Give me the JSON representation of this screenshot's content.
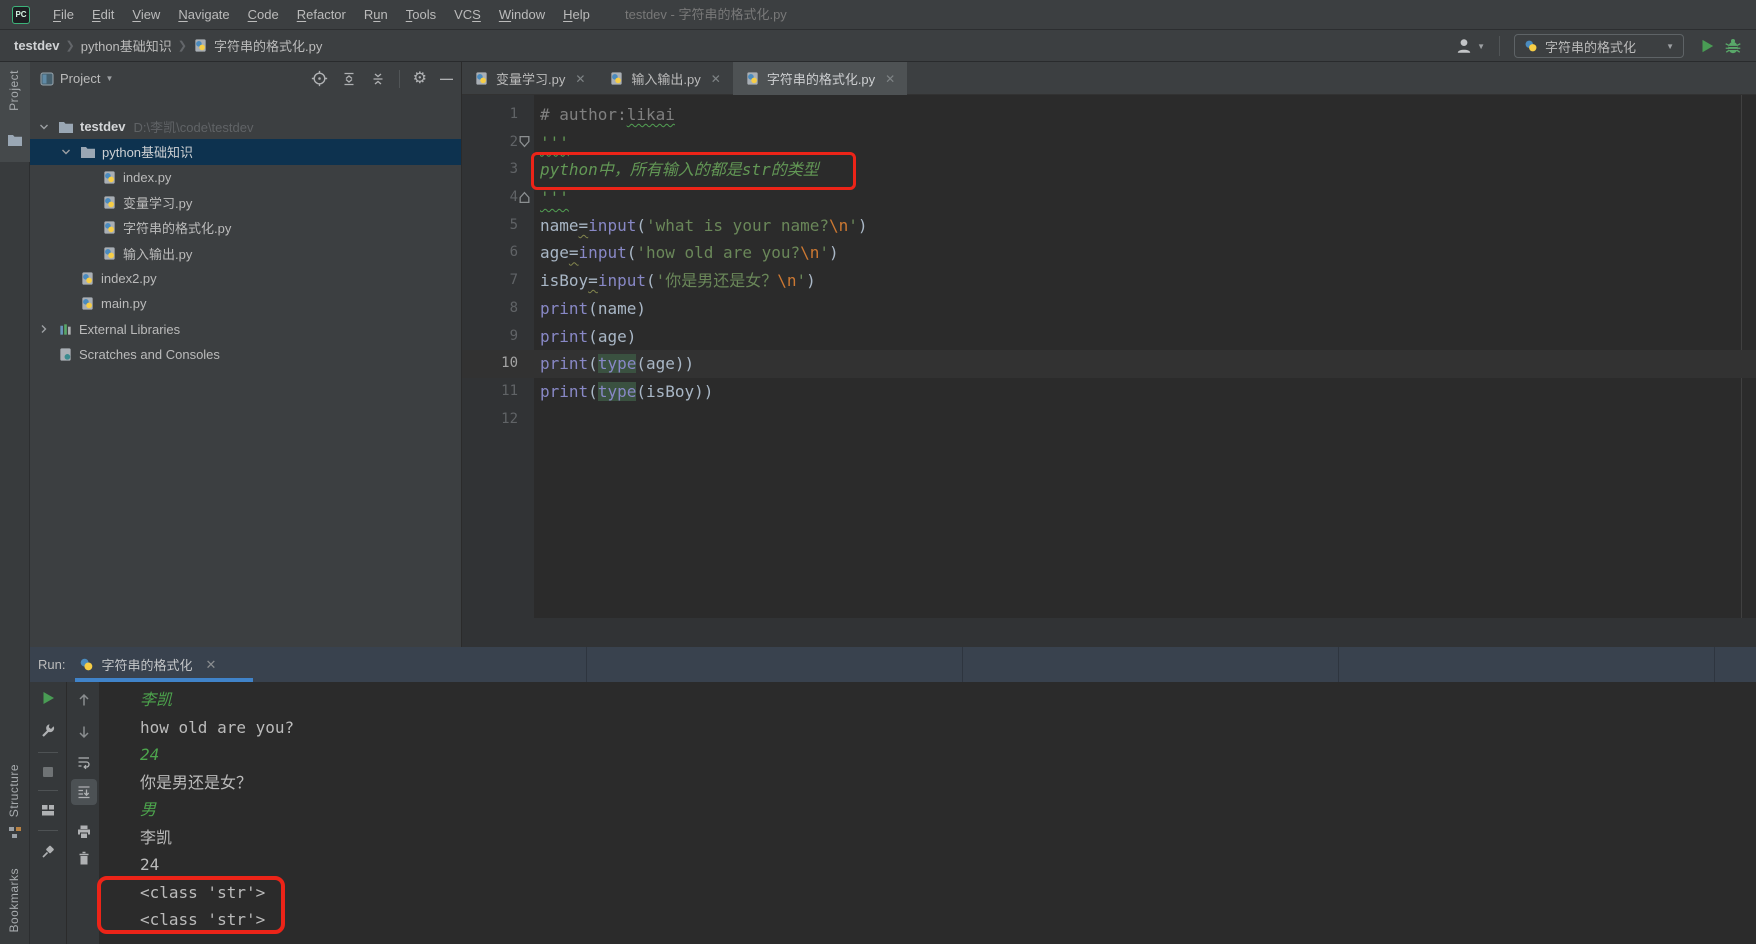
{
  "window": {
    "title": "testdev - 字符串的格式化.py",
    "logo": "PC"
  },
  "menu": {
    "items": [
      {
        "pre": "",
        "key": "F",
        "post": "ile"
      },
      {
        "pre": "",
        "key": "E",
        "post": "dit"
      },
      {
        "pre": "",
        "key": "V",
        "post": "iew"
      },
      {
        "pre": "",
        "key": "N",
        "post": "avigate"
      },
      {
        "pre": "",
        "key": "C",
        "post": "ode"
      },
      {
        "pre": "",
        "key": "R",
        "post": "efactor"
      },
      {
        "pre": "R",
        "key": "u",
        "post": "n"
      },
      {
        "pre": "",
        "key": "T",
        "post": "ools"
      },
      {
        "pre": "VC",
        "key": "S",
        "post": ""
      },
      {
        "pre": "",
        "key": "W",
        "post": "indow"
      },
      {
        "pre": "",
        "key": "H",
        "post": "elp"
      }
    ]
  },
  "breadcrumbs": {
    "items": [
      "testdev",
      "python基础知识",
      "字符串的格式化.py"
    ]
  },
  "toolbar": {
    "run_config": "字符串的格式化"
  },
  "stripes": {
    "project": "Project",
    "structure": "Structure",
    "bookmarks": "Bookmarks"
  },
  "project_panel": {
    "title": "Project",
    "tree": [
      {
        "label": "testdev",
        "path": "D:\\李凯\\code\\testdev",
        "indent": 0,
        "icon": "folder",
        "chevron": "down",
        "bold": true
      },
      {
        "label": "python基础知识",
        "indent": 1,
        "icon": "folder",
        "chevron": "down",
        "selected": true
      },
      {
        "label": "index.py",
        "indent": 2,
        "icon": "py"
      },
      {
        "label": "变量学习.py",
        "indent": 2,
        "icon": "py"
      },
      {
        "label": "字符串的格式化.py",
        "indent": 2,
        "icon": "py"
      },
      {
        "label": "输入输出.py",
        "indent": 2,
        "icon": "py"
      },
      {
        "label": "index2.py",
        "indent": 1,
        "icon": "py"
      },
      {
        "label": "main.py",
        "indent": 1,
        "icon": "py"
      },
      {
        "label": "External Libraries",
        "indent": 0,
        "icon": "lib",
        "chevron": "right"
      },
      {
        "label": "Scratches and Consoles",
        "indent": 0,
        "icon": "scratch"
      }
    ]
  },
  "editor": {
    "tabs": [
      {
        "label": "变量学习.py",
        "active": false
      },
      {
        "label": "输入输出.py",
        "active": false
      },
      {
        "label": "字符串的格式化.py",
        "active": true
      }
    ],
    "current_line": 10,
    "lines": [
      {
        "n": 1,
        "tokens": [
          [
            "# author:",
            "cm"
          ],
          [
            "likai",
            "cm wg"
          ]
        ]
      },
      {
        "n": 2,
        "tokens": [
          [
            "'''",
            "doc wd"
          ]
        ]
      },
      {
        "n": 3,
        "tokens": [
          [
            "python中，所有输入的都是str的类型",
            "doc"
          ]
        ]
      },
      {
        "n": 4,
        "tokens": [
          [
            "'''",
            "doc wd"
          ]
        ]
      },
      {
        "n": 5,
        "tokens": [
          [
            "name",
            "pl"
          ],
          [
            "=",
            "pl ww"
          ],
          [
            "input",
            "fn"
          ],
          [
            "(",
            "pl"
          ],
          [
            "'what is your name?",
            "st"
          ],
          [
            "\\n",
            "es"
          ],
          [
            "'",
            "st"
          ],
          [
            ")",
            "pl"
          ]
        ]
      },
      {
        "n": 6,
        "tokens": [
          [
            "age",
            "pl"
          ],
          [
            "=",
            "pl ww"
          ],
          [
            "input",
            "fn"
          ],
          [
            "(",
            "pl"
          ],
          [
            "'how old are you?",
            "st"
          ],
          [
            "\\n",
            "es"
          ],
          [
            "'",
            "st"
          ],
          [
            ")",
            "pl"
          ]
        ]
      },
      {
        "n": 7,
        "tokens": [
          [
            "isBoy",
            "pl"
          ],
          [
            "=",
            "pl ww"
          ],
          [
            "input",
            "fn"
          ],
          [
            "(",
            "pl"
          ],
          [
            "'你是男还是女？",
            "st"
          ],
          [
            "\\n",
            "es"
          ],
          [
            "'",
            "st"
          ],
          [
            ")",
            "pl"
          ]
        ]
      },
      {
        "n": 8,
        "tokens": [
          [
            "print",
            "fn"
          ],
          [
            "(",
            "pl"
          ],
          [
            "name",
            "pl"
          ],
          [
            ")",
            "pl"
          ]
        ]
      },
      {
        "n": 9,
        "tokens": [
          [
            "print",
            "fn"
          ],
          [
            "(",
            "pl"
          ],
          [
            "age",
            "pl"
          ],
          [
            ")",
            "pl"
          ]
        ]
      },
      {
        "n": 10,
        "tokens": [
          [
            "print",
            "fn"
          ],
          [
            "(",
            "pl"
          ],
          [
            "type",
            "fn hl"
          ],
          [
            "(",
            "pl"
          ],
          [
            "age",
            "pl"
          ],
          [
            "))",
            "pl"
          ]
        ]
      },
      {
        "n": 11,
        "tokens": [
          [
            "print",
            "fn"
          ],
          [
            "(",
            "pl"
          ],
          [
            "type",
            "fn hl"
          ],
          [
            "(",
            "pl"
          ],
          [
            "isBoy",
            "pl"
          ],
          [
            "))",
            "pl"
          ]
        ]
      },
      {
        "n": 12,
        "tokens": []
      }
    ]
  },
  "run_panel": {
    "label": "Run:",
    "tab": "字符串的格式化",
    "console": [
      {
        "text": "李凯",
        "style": "in"
      },
      {
        "text": "how old are you?",
        "style": "std"
      },
      {
        "text": "24",
        "style": "in"
      },
      {
        "text": "你是男还是女？",
        "style": "std"
      },
      {
        "text": "男",
        "style": "in"
      },
      {
        "text": "李凯",
        "style": "std"
      },
      {
        "text": "24",
        "style": "std"
      },
      {
        "text": "<class 'str'>",
        "style": "std"
      },
      {
        "text": "<class 'str'>",
        "style": "std"
      }
    ]
  },
  "colors": {
    "annotation_red": "#ec2418",
    "run_green": "#499c54",
    "tab_indicator_blue": "#4083c9",
    "selection_blue": "#0d324f",
    "editor_bg": "#2b2b2b",
    "panel_bg": "#3c3f41"
  }
}
